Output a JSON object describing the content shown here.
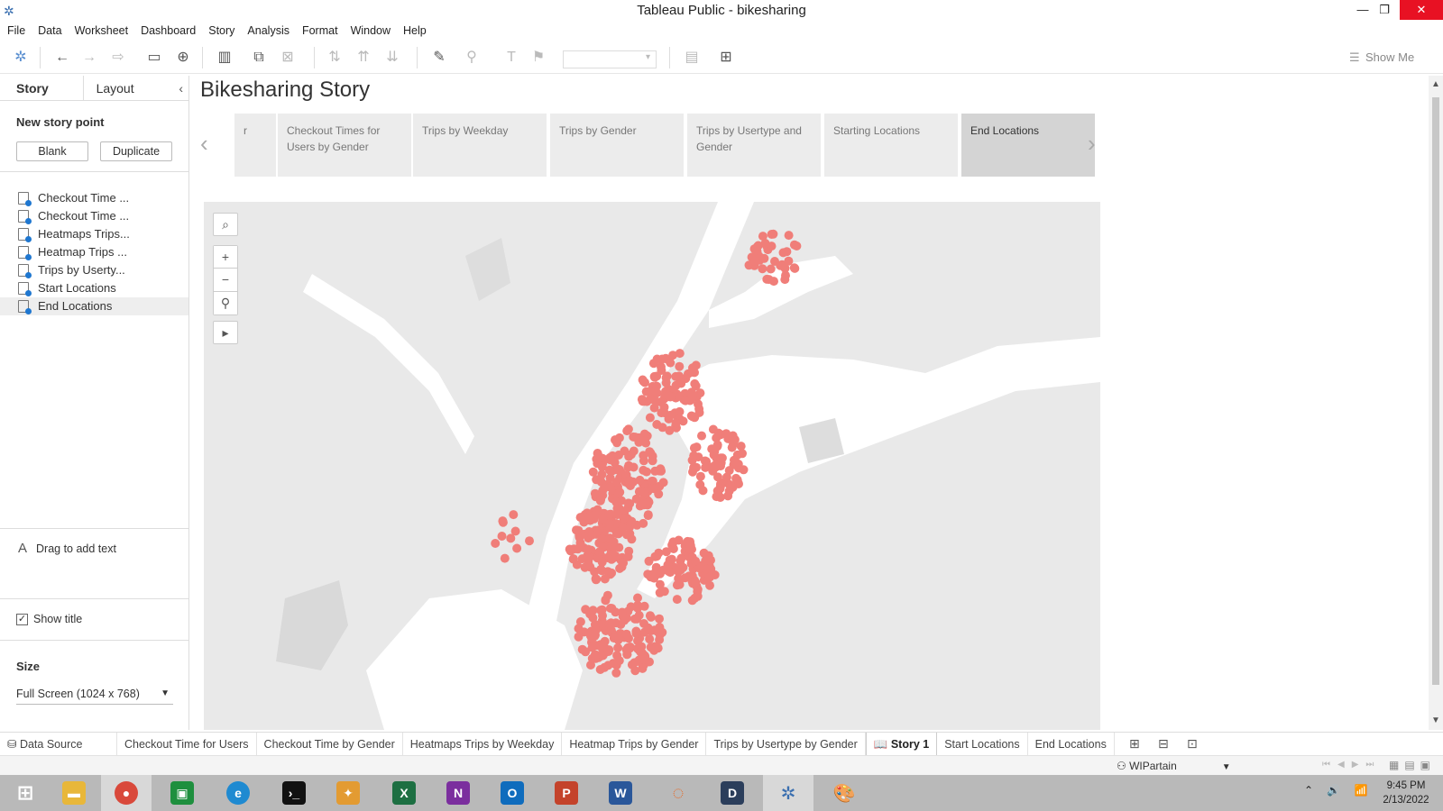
{
  "window": {
    "title": "Tableau Public - bikesharing"
  },
  "menu": [
    "File",
    "Data",
    "Worksheet",
    "Dashboard",
    "Story",
    "Analysis",
    "Format",
    "Window",
    "Help"
  ],
  "toolbar": {
    "show_me": "Show Me"
  },
  "left_pane": {
    "tab_story": "Story",
    "tab_layout": "Layout",
    "new_story_point": "New story point",
    "btn_blank": "Blank",
    "btn_duplicate": "Duplicate",
    "story_points": [
      "Checkout Time ...",
      "Checkout Time ...",
      "Heatmaps Trips...",
      "Heatmap Trips ...",
      "Trips by Userty...",
      "Start Locations",
      "End Locations"
    ],
    "drag_to_add_text": "Drag to add text",
    "show_title": "Show title",
    "size_label": "Size",
    "size_value": "Full Screen (1024 x 768)"
  },
  "story": {
    "title": "Bikesharing Story",
    "cards": [
      "r",
      "Checkout Times for Users by Gender",
      "Trips by Weekday",
      "Trips by Gender",
      "Trips by Usertype and Gender",
      "Starting Locations",
      "End Locations"
    ],
    "selected_card": "End Locations"
  },
  "map": {
    "point_color": "#f07e79",
    "land_color": "#e9e9e9",
    "water_color": "#ffffff"
  },
  "sheet_tabs": {
    "data_source": "Data Source",
    "tabs": [
      "Checkout Time for Users",
      "Checkout Time by Gender",
      "Heatmaps Trips by Weekday",
      "Heatmap Trips by Gender",
      "Trips by Usertype by Gender",
      "Story 1",
      "Start Locations",
      "End Locations"
    ],
    "active": "Story 1"
  },
  "status": {
    "user": "WIPartain"
  },
  "taskbar": {
    "time": "9:45 PM",
    "date": "2/13/2022"
  }
}
